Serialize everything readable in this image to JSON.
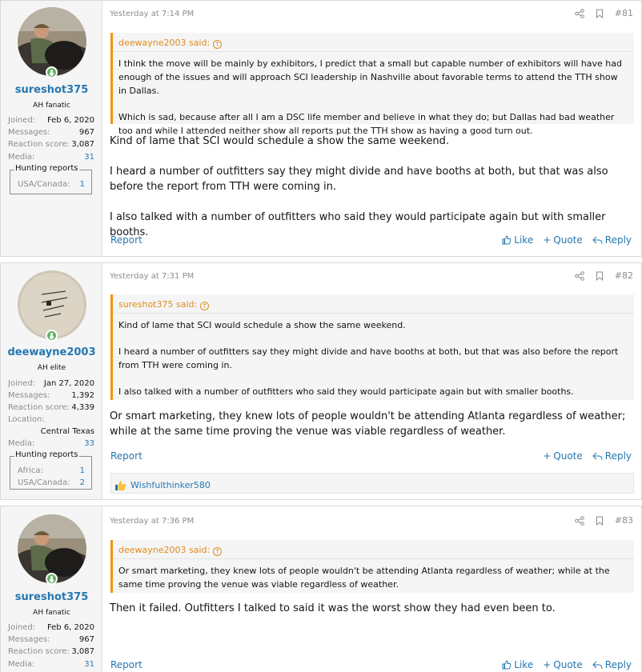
{
  "posts": [
    {
      "user": {
        "name": "sureshot375",
        "title": "AH fanatic",
        "stats": [
          {
            "label": "Joined:",
            "value": "Feb 6, 2020"
          },
          {
            "label": "Messages:",
            "value": "967"
          },
          {
            "label": "Reaction score:",
            "value": "3,087"
          },
          {
            "label": "Media:",
            "value": "31"
          }
        ],
        "hunting_reports_label": "Hunting reports",
        "hunting_reports": [
          {
            "label": "USA/Canada:",
            "value": "1"
          }
        ]
      },
      "time": "Yesterday at 7:14 PM",
      "number": "#81",
      "quote": {
        "author": "deewayne2003 said:",
        "paragraphs": [
          "I think the move will be mainly by exhibitors, I predict that a small but capable number of exhibitors will have had enough of the issues and will approach SCI leadership in Nashville about favorable terms to attend the TTH show in Dallas.",
          "Which is sad, because after all I am a DSC life member and believe in what they do; but Dallas had bad weather too and while I attended neither show all reports put the TTH show as having a good turn out."
        ]
      },
      "paragraphs": [
        "Kind of lame that SCI would schedule a show the same weekend.",
        "I heard a number of outfitters say they might divide and have booths at both, but that was also before the report from TTH were coming in.",
        "I also talked with a number of outfitters who said they would participate again but with smaller booths."
      ],
      "actions": {
        "report": "Report",
        "like": "Like",
        "quote": "Quote",
        "reply": "Reply"
      }
    },
    {
      "user": {
        "name": "deewayne2003",
        "title": "AH elite",
        "stats": [
          {
            "label": "Joined:",
            "value": "Jan 27, 2020"
          },
          {
            "label": "Messages:",
            "value": "1,392"
          },
          {
            "label": "Reaction score:",
            "value": "4,339"
          }
        ],
        "location_label": "Location:",
        "location": "Central Texas",
        "media_label": "Media:",
        "media": "33",
        "hunting_reports_label": "Hunting reports",
        "hunting_reports": [
          {
            "label": "Africa:",
            "value": "1"
          },
          {
            "label": "USA/Canada:",
            "value": "2"
          }
        ]
      },
      "time": "Yesterday at 7:31 PM",
      "number": "#82",
      "quote": {
        "author": "sureshot375 said:",
        "paragraphs": [
          "Kind of lame that SCI would schedule a show the same weekend.",
          "I heard a number of outfitters say they might divide and have booths at both, but that was also before the report from TTH were coming in.",
          "I also talked with a number of outfitters who said they would participate again but with smaller booths."
        ]
      },
      "paragraphs": [
        "Or smart marketing, they knew lots of people wouldn't be attending Atlanta regardless of weather; while at the same time proving the venue was viable regardless of weather."
      ],
      "actions": {
        "report": "Report",
        "quote": "Quote",
        "reply": "Reply"
      },
      "reaction_user": "Wishfulthinker580"
    },
    {
      "user": {
        "name": "sureshot375",
        "title": "AH fanatic",
        "stats": [
          {
            "label": "Joined:",
            "value": "Feb 6, 2020"
          },
          {
            "label": "Messages:",
            "value": "967"
          },
          {
            "label": "Reaction score:",
            "value": "3,087"
          },
          {
            "label": "Media:",
            "value": "31"
          }
        ]
      },
      "time": "Yesterday at 7:36 PM",
      "number": "#83",
      "quote": {
        "author": "deewayne2003 said:",
        "paragraphs": [
          "Or smart marketing, they knew lots of people wouldn't be attending Atlanta regardless of weather; while at the same time proving the venue was viable regardless of weather."
        ]
      },
      "paragraphs": [
        "Then it failed. Outfitters I talked to said it was the worst show they had even been to."
      ],
      "actions": {
        "report": "Report",
        "like": "Like",
        "quote": "Quote",
        "reply": "Reply"
      }
    }
  ],
  "colors": {
    "link": "#2577b1",
    "quote_accent": "#f2930d",
    "online": "#63b265",
    "muted": "#8c8c8c"
  },
  "icons": [
    "share-icon",
    "bookmark-icon",
    "like-icon",
    "plus-icon",
    "reply-icon",
    "arrow-up-icon"
  ]
}
